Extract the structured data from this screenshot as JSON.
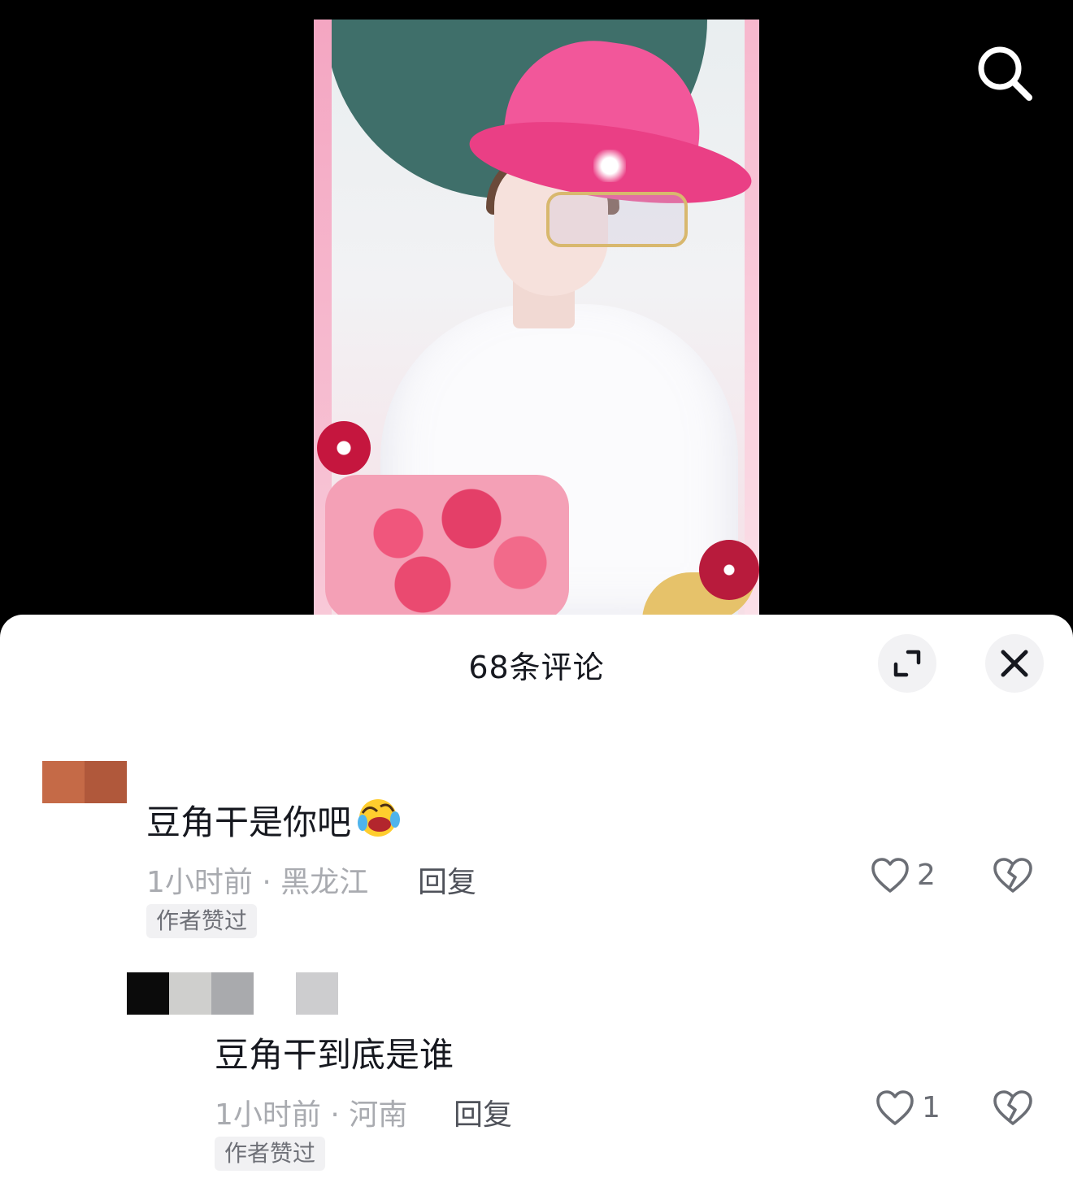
{
  "sheet": {
    "title": "68条评论"
  },
  "comments": [
    {
      "text": "豆角干是你吧",
      "emoji": "rolling-on-floor-laughing-emoji",
      "time_location": "1小时前 · 黑龙江",
      "reply_label": "回复",
      "author_liked_tag": "作者赞过",
      "like_count": "2"
    },
    {
      "text": "豆角干到底是谁",
      "time_location": "1小时前 · 河南",
      "reply_label": "回复",
      "author_liked_tag": "作者赞过",
      "like_count": "1"
    }
  ],
  "icons": {
    "search": "search-icon",
    "expand": "expand-icon",
    "close": "close-icon",
    "like": "heart-icon",
    "dislike": "broken-heart-icon"
  },
  "colors": {
    "background": "#000000",
    "sheet": "#ffffff",
    "primary_text": "#16181f",
    "secondary_text": "#a9abb0",
    "tag_bg": "#f1f1f3"
  }
}
